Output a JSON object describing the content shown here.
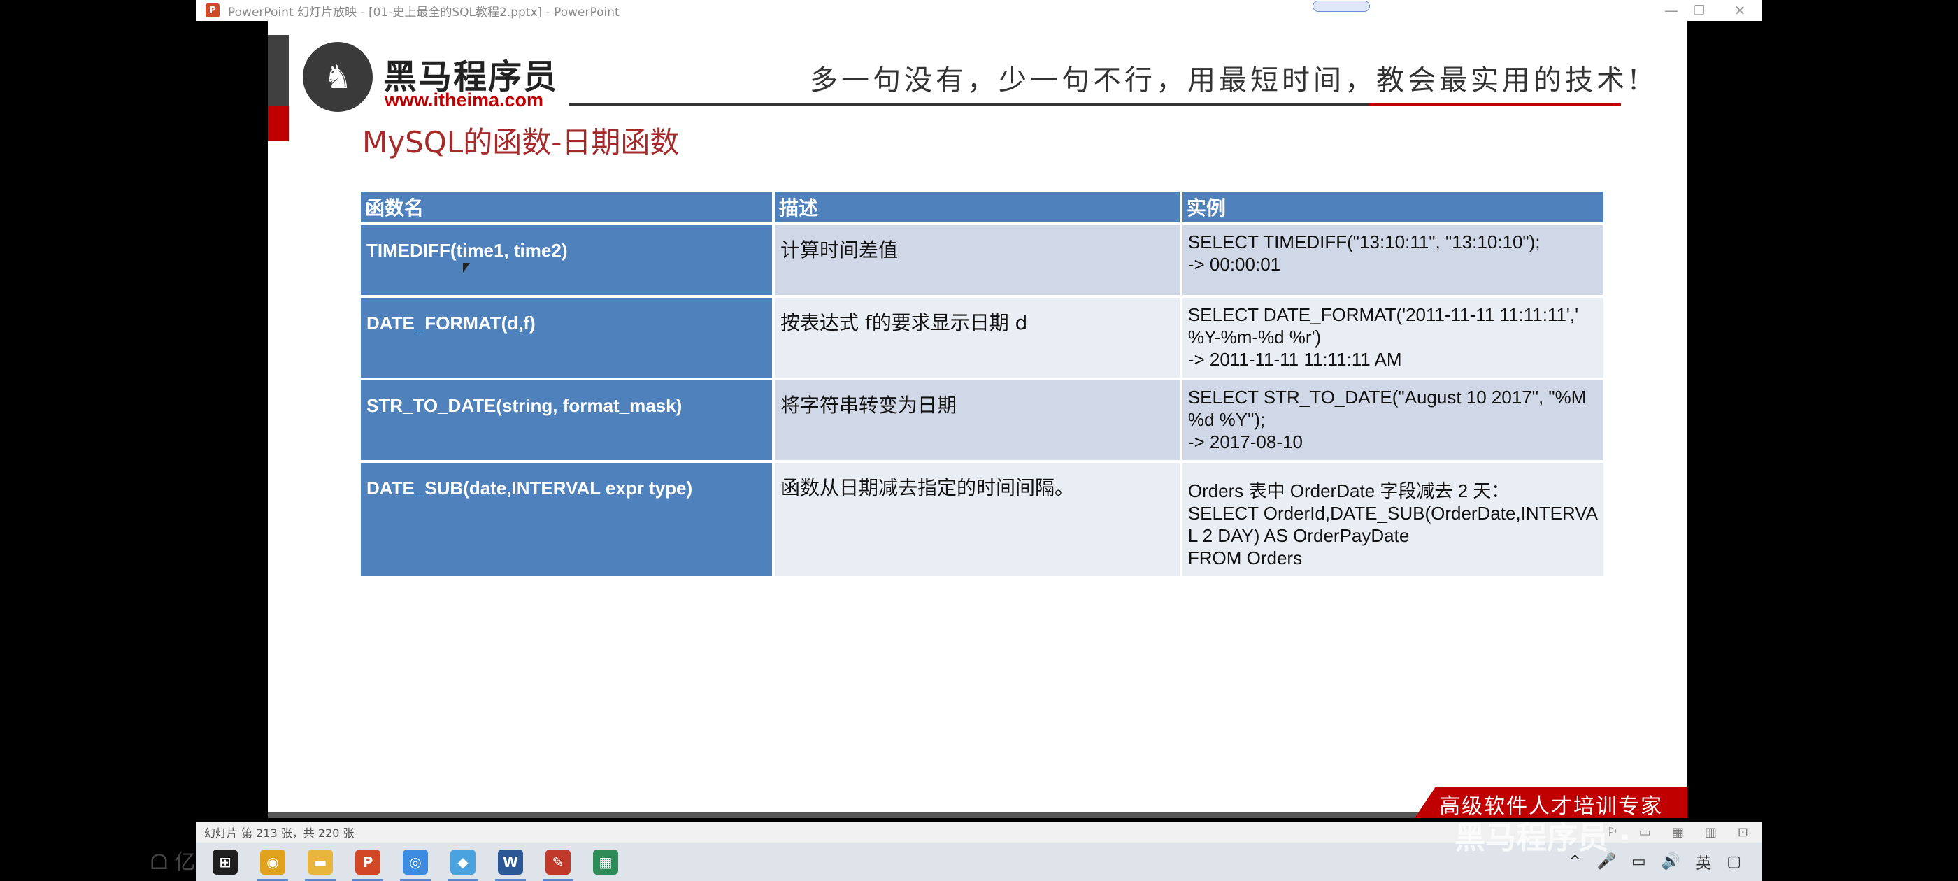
{
  "window": {
    "title": "PowerPoint 幻灯片放映 - [01-史上最全的SQL教程2.pptx] - PowerPoint",
    "controls": {
      "minimize": "—",
      "restore": "❐",
      "close": "✕"
    }
  },
  "slide": {
    "logo_name": "黑马程序员",
    "logo_url": "www.itheima.com",
    "slogan": "多一句没有，少一句不行，用最短时间，教会最实用的技术!",
    "title": "MySQL的函数-日期函数",
    "footer_slogan": "高级软件人才培训专家",
    "table": {
      "headers": [
        "函数名",
        "描述",
        "实例"
      ],
      "rows": [
        {
          "name": "TIMEDIFF(time1, time2)",
          "desc": "计算时间差值",
          "example": [
            "SELECT TIMEDIFF(\"13:10:11\", \"13:10:10\");",
            "-> 00:00:01"
          ]
        },
        {
          "name": "DATE_FORMAT(d,f)",
          "desc": "按表达式 f的要求显示日期 d",
          "example": [
            "SELECT DATE_FORMAT('2011-11-11 11:11:11','",
            "%Y-%m-%d %r')",
            "-> 2011-11-11 11:11:11 AM"
          ]
        },
        {
          "name": "STR_TO_DATE(string, format_mask)",
          "desc": "将字符串转变为日期",
          "example": [
            "SELECT STR_TO_DATE(\"August 10 2017\", \"%M",
            "%d %Y\");",
            "-> 2017-08-10"
          ]
        },
        {
          "name": "DATE_SUB(date,INTERVAL expr type)",
          "desc": "函数从日期减去指定的时间间隔。",
          "example": [
            "Orders 表中 OrderDate 字段减去 2 天：",
            "SELECT OrderId,DATE_SUB(OrderDate,INTERVA",
            "L 2 DAY) AS OrderPayDate",
            "FROM Orders"
          ]
        }
      ]
    }
  },
  "statusbar": {
    "slide_count": "幻灯片 第 213 张，共 220 张"
  },
  "taskbar": {
    "apps": [
      {
        "name": "windows-start-icon",
        "color": "#1e1e1e",
        "glyph": "⊞"
      },
      {
        "name": "chrome-icon",
        "color": "#e0a21c",
        "glyph": "◉"
      },
      {
        "name": "file-explorer-icon",
        "color": "#e8b53d",
        "glyph": "▬"
      },
      {
        "name": "powerpoint-icon",
        "color": "#d24726",
        "glyph": "P"
      },
      {
        "name": "browser-icon",
        "color": "#3b8be0",
        "glyph": "◎"
      },
      {
        "name": "app-icon",
        "color": "#4aa3df",
        "glyph": "◆"
      },
      {
        "name": "word-icon",
        "color": "#2b5797",
        "glyph": "W"
      },
      {
        "name": "pen-tool-icon",
        "color": "#c0392b",
        "glyph": "✎"
      },
      {
        "name": "chart-app-icon",
        "color": "#2e8b57",
        "glyph": "▦"
      }
    ],
    "tray": [
      "^",
      "🎤",
      "▭",
      "🔊",
      "英",
      "▢"
    ]
  },
  "overlay": {
    "watermark_left": "ᗝ 亿",
    "watermark_right": "黑马程序员 ·"
  }
}
